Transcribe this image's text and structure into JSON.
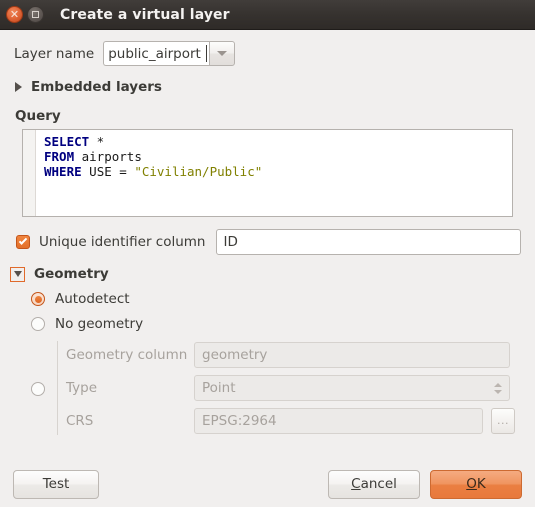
{
  "window": {
    "title": "Create a virtual layer",
    "close_icon": "close-icon",
    "maximize_icon": "maximize-icon"
  },
  "layer_name": {
    "label": "Layer name",
    "value": "public_airport",
    "placeholder": "",
    "dropdown_icon": "chevron-down-icon"
  },
  "embedded_layers": {
    "label": "Embedded layers",
    "expanded": false,
    "toggle_icon": "triangle-right-icon"
  },
  "query": {
    "label": "Query",
    "lines": [
      {
        "keyword": "SELECT",
        "rest": " *",
        "string": ""
      },
      {
        "keyword": "FROM",
        "rest": " airports",
        "string": ""
      },
      {
        "keyword": "WHERE",
        "rest": " USE = ",
        "string": "\"Civilian/Public\""
      }
    ],
    "text": "SELECT *\nFROM airports\nWHERE USE = \"Civilian/Public\""
  },
  "unique_identifier": {
    "label": "Unique identifier column",
    "checked": true,
    "value": "ID",
    "placeholder": ""
  },
  "geometry": {
    "label": "Geometry",
    "expanded": true,
    "toggle_icon": "triangle-down-icon",
    "options": [
      {
        "label": "Autodetect",
        "selected": true
      },
      {
        "label": "No geometry",
        "selected": false
      },
      {
        "label": "",
        "selected": false
      }
    ],
    "fields": [
      {
        "label": "Geometry column",
        "value": "geometry",
        "disabled": true
      },
      {
        "label": "Type",
        "value": "Point",
        "disabled": true
      },
      {
        "label": "CRS",
        "value": "EPSG:2964",
        "disabled": true
      }
    ],
    "crs_browse_label": "...",
    "spinner_icon": "spinner-arrows-icon"
  },
  "footer": {
    "test": "Test",
    "cancel_prefix": "",
    "cancel_accel": "C",
    "cancel_suffix": "ancel",
    "ok_prefix": "",
    "ok_accel": "O",
    "ok_suffix": "K"
  },
  "colors": {
    "accent_orange": "#e8793c",
    "background": "#f1efee",
    "titlebar": "#36322f",
    "sql_keyword": "#000080",
    "sql_string": "#808000",
    "disabled_text": "#a7a29d"
  }
}
